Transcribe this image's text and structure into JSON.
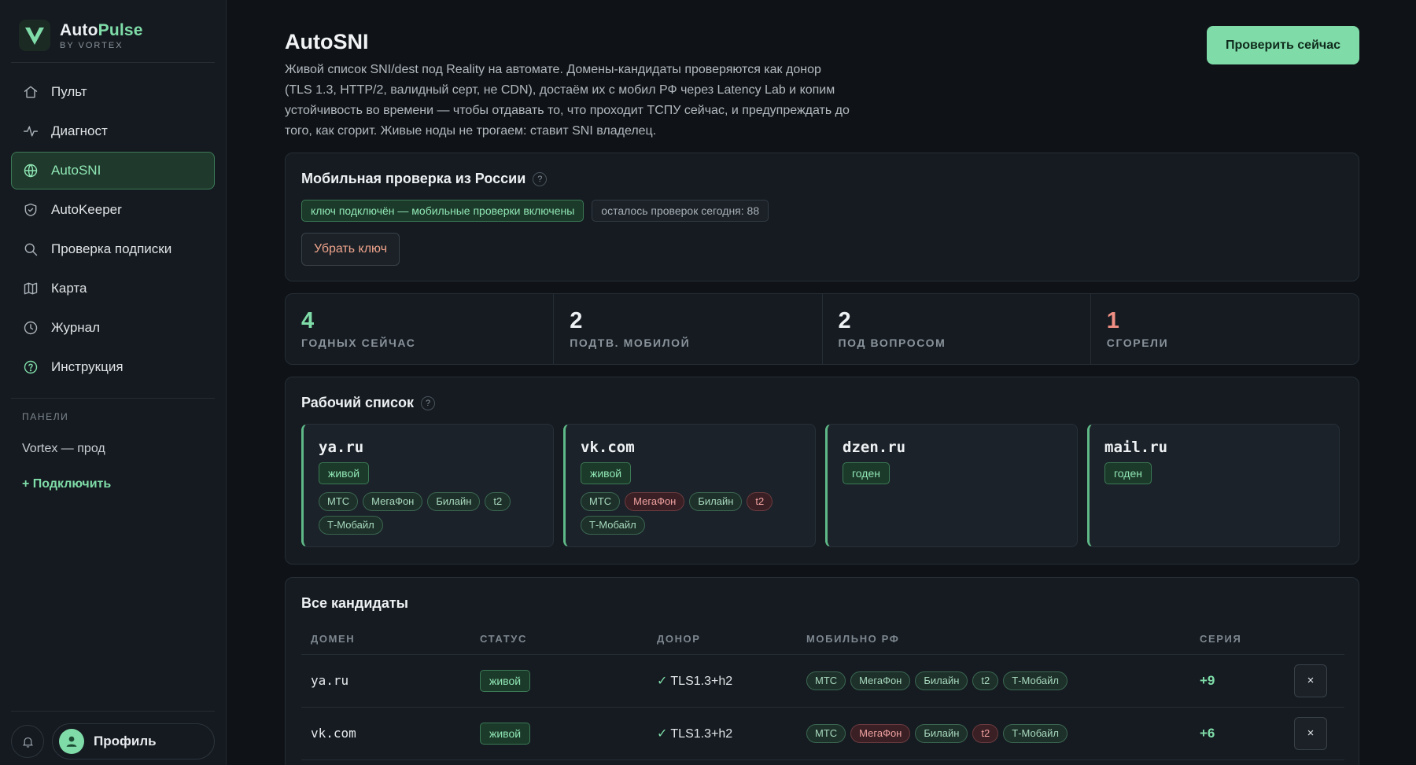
{
  "brand": {
    "name_main": "Auto",
    "name_accent": "Pulse",
    "subtitle": "BY VORTEX"
  },
  "nav": [
    {
      "label": "Пульт",
      "icon": "home-icon"
    },
    {
      "label": "Диагност",
      "icon": "pulse-icon"
    },
    {
      "label": "AutoSNI",
      "icon": "globe-icon",
      "active": true
    },
    {
      "label": "AutoKeeper",
      "icon": "shield-icon"
    },
    {
      "label": "Проверка подписки",
      "icon": "search-icon"
    },
    {
      "label": "Карта",
      "icon": "map-icon"
    },
    {
      "label": "Журнал",
      "icon": "clock-icon"
    },
    {
      "label": "Инструкция",
      "icon": "help-icon"
    }
  ],
  "panels": {
    "label": "ПАНЕЛИ",
    "item": "Vortex — прод",
    "connect": "+ Подключить"
  },
  "profile": {
    "label": "Профиль"
  },
  "page": {
    "title": "AutoSNI",
    "description": "Живой список SNI/dest под Reality на автомате. Домены-кандидаты проверяются как донор (TLS 1.3, HTTP/2, валидный серт, не CDN), достаём их с мобил РФ через Latency Lab и копим устойчивость во времени — чтобы отдавать то, что проходит ТСПУ сейчас, и предупреждать до того, как сгорит. Живые ноды не трогаем: ставит SNI владелец.",
    "check_button": "Проверить сейчас"
  },
  "mobile_check": {
    "title": "Мобильная проверка из России",
    "help": "?",
    "key_badge": "ключ подключён — мобильные проверки включены",
    "remaining_badge": "осталось проверок сегодня: 88",
    "remove_button": "Убрать ключ"
  },
  "stats": [
    {
      "value": "4",
      "label": "ГОДНЫХ СЕЙЧАС",
      "color": "#7fdca8"
    },
    {
      "value": "2",
      "label": "ПОДТВ. МОБИЛОЙ",
      "color": "#eef1f3"
    },
    {
      "value": "2",
      "label": "ПОД ВОПРОСОМ",
      "color": "#eef1f3"
    },
    {
      "value": "1",
      "label": "СГОРЕЛИ",
      "color": "#f08f84"
    }
  ],
  "worklist": {
    "title": "Рабочий список",
    "help": "?",
    "items": [
      {
        "domain": "ya.ru",
        "status": "живой",
        "operators": [
          {
            "name": "МТС",
            "ok": true
          },
          {
            "name": "МегаФон",
            "ok": true
          },
          {
            "name": "Билайн",
            "ok": true
          },
          {
            "name": "t2",
            "ok": true
          },
          {
            "name": "Т-Мобайл",
            "ok": true
          }
        ]
      },
      {
        "domain": "vk.com",
        "status": "живой",
        "operators": [
          {
            "name": "МТС",
            "ok": true
          },
          {
            "name": "МегаФон",
            "ok": false
          },
          {
            "name": "Билайн",
            "ok": true
          },
          {
            "name": "t2",
            "ok": false
          },
          {
            "name": "Т-Мобайл",
            "ok": true
          }
        ]
      },
      {
        "domain": "dzen.ru",
        "status": "годен",
        "operators": []
      },
      {
        "domain": "mail.ru",
        "status": "годен",
        "operators": []
      }
    ]
  },
  "candidates": {
    "title": "Все кандидаты",
    "columns": [
      "ДОМЕН",
      "СТАТУС",
      "ДОНОР",
      "МОБИЛЬНО РФ",
      "СЕРИЯ"
    ],
    "rows": [
      {
        "domain": "ya.ru",
        "status": "живой",
        "donor": "TLS1.3+h2",
        "series": "+9",
        "operators": [
          {
            "name": "МТС",
            "ok": true
          },
          {
            "name": "МегаФон",
            "ok": true
          },
          {
            "name": "Билайн",
            "ok": true
          },
          {
            "name": "t2",
            "ok": true
          },
          {
            "name": "Т-Мобайл",
            "ok": true
          }
        ]
      },
      {
        "domain": "vk.com",
        "status": "живой",
        "donor": "TLS1.3+h2",
        "series": "+6",
        "operators": [
          {
            "name": "МТС",
            "ok": true
          },
          {
            "name": "МегаФон",
            "ok": false
          },
          {
            "name": "Билайн",
            "ok": true
          },
          {
            "name": "t2",
            "ok": false
          },
          {
            "name": "Т-Мобайл",
            "ok": true
          }
        ]
      }
    ],
    "remove_glyph": "×"
  }
}
